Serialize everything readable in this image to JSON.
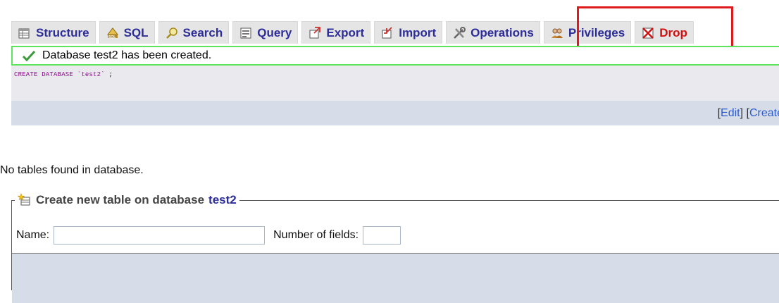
{
  "tabs": [
    {
      "label": "Structure",
      "icon": "structure-icon"
    },
    {
      "label": "SQL",
      "icon": "sql-icon"
    },
    {
      "label": "Search",
      "icon": "search-icon"
    },
    {
      "label": "Query",
      "icon": "query-icon"
    },
    {
      "label": "Export",
      "icon": "export-icon"
    },
    {
      "label": "Import",
      "icon": "import-icon"
    },
    {
      "label": "Operations",
      "icon": "operations-icon"
    },
    {
      "label": "Privileges",
      "icon": "privileges-icon"
    },
    {
      "label": "Drop",
      "icon": "drop-icon"
    }
  ],
  "notice": {
    "message": "Database test2 has been created."
  },
  "sql": {
    "keyword": "CREATE DATABASE",
    "name": "`test2`",
    "end": ";"
  },
  "actions": {
    "open": "[ ",
    "edit": "Edit",
    "mid": " ] [ ",
    "create": "Create"
  },
  "no_tables": "No tables found in database.",
  "new_table": {
    "legend_prefix": "Create new table on database",
    "db": "test2",
    "name_label": "Name:",
    "fields_label": "Number of fields:",
    "name_value": "",
    "fields_value": ""
  },
  "colors": {
    "highlight": "#e0191c",
    "notice_border": "#5de65d",
    "tab_text": "#2d2d9a",
    "drop_text": "#d01010"
  }
}
